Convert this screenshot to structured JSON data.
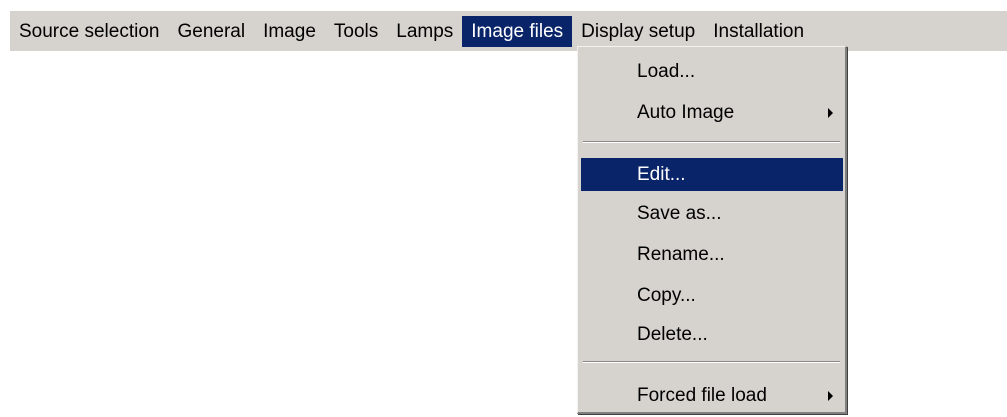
{
  "menubar": {
    "items": [
      {
        "label": "Source selection"
      },
      {
        "label": "General"
      },
      {
        "label": "Image"
      },
      {
        "label": "Tools"
      },
      {
        "label": "Lamps"
      },
      {
        "label": "Image files",
        "selected": true
      },
      {
        "label": "Display setup"
      },
      {
        "label": "Installation"
      }
    ]
  },
  "dropdown": {
    "items": [
      {
        "label": "Load..."
      },
      {
        "label": "Auto Image",
        "submenu": true
      },
      {
        "label": "Edit...",
        "highlighted": true
      },
      {
        "label": "Save as..."
      },
      {
        "label": "Rename..."
      },
      {
        "label": "Copy..."
      },
      {
        "label": "Delete..."
      },
      {
        "label": "Forced file load",
        "submenu": true
      }
    ],
    "arrow_icon": "triangle-right-icon"
  },
  "colors": {
    "menu_background": "#d6d3ce",
    "selection_background": "#0a246a",
    "selection_text": "#ffffff"
  }
}
